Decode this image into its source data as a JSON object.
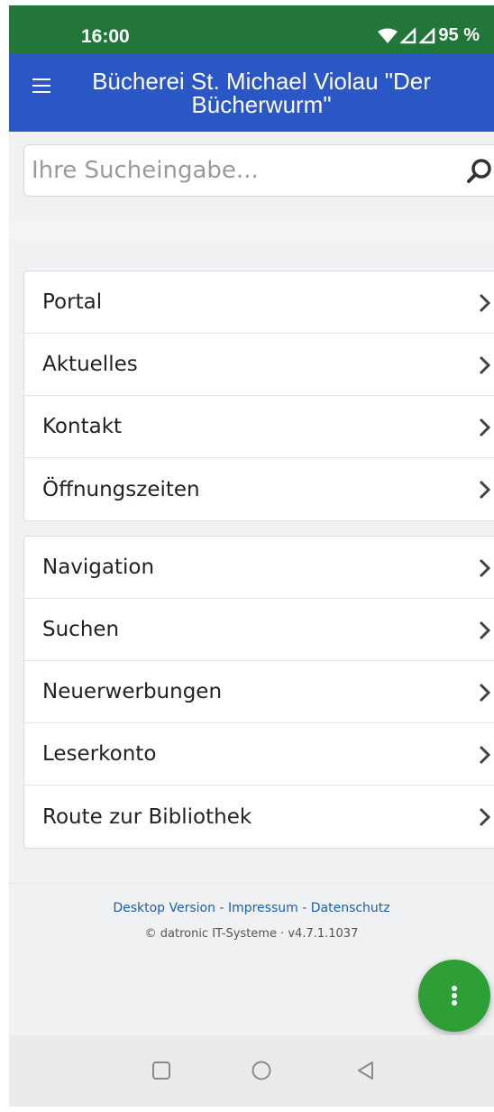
{
  "status": {
    "time": "16:00",
    "battery": "95 %"
  },
  "app": {
    "title_line1": "Bücherei St. Michael Violau \"Der",
    "title_line2": "Bücherwurm\""
  },
  "search": {
    "placeholder": "Ihre Sucheingabe..."
  },
  "menu_group_1": [
    {
      "label": "Portal"
    },
    {
      "label": "Aktuelles"
    },
    {
      "label": "Kontakt"
    },
    {
      "label": "Öffnungszeiten"
    }
  ],
  "menu_group_2": [
    {
      "label": "Navigation"
    },
    {
      "label": "Suchen"
    },
    {
      "label": "Neuerwerbungen"
    },
    {
      "label": "Leserkonto"
    },
    {
      "label": "Route zur Bibliothek"
    }
  ],
  "footer": {
    "desktop": "Desktop Version",
    "sep1": " - ",
    "impressum": "Impressum",
    "sep2": " - ",
    "datenschutz": "Datenschutz",
    "copyright": "© datronic IT-Systeme · v4.7.1.1037"
  },
  "colors": {
    "statusbar": "#23763a",
    "appbar": "#2a56c6",
    "fab": "#2e9e36",
    "link": "#1d5fa8"
  },
  "icons": [
    "wifi-icon",
    "signal-icon",
    "menu-icon",
    "search-icon",
    "chevron-right-icon",
    "more-vert-icon",
    "recents-icon",
    "home-icon",
    "back-icon"
  ]
}
